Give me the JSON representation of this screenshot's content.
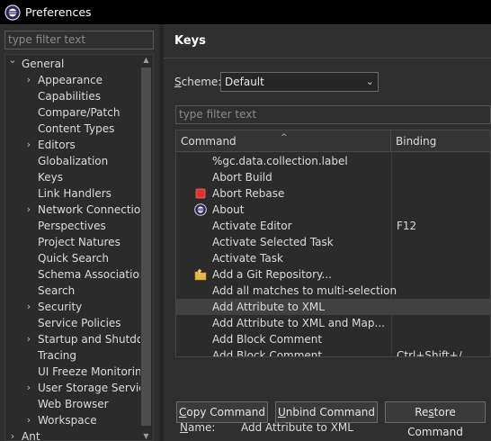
{
  "window": {
    "title": "Preferences"
  },
  "left": {
    "filter_placeholder": "type filter text",
    "tree": [
      {
        "label": "General",
        "expanded": true,
        "level": 0
      },
      {
        "label": "Appearance",
        "expandable": true,
        "level": 1
      },
      {
        "label": "Capabilities",
        "level": 1
      },
      {
        "label": "Compare/Patch",
        "level": 1
      },
      {
        "label": "Content Types",
        "level": 1
      },
      {
        "label": "Editors",
        "expandable": true,
        "level": 1
      },
      {
        "label": "Globalization",
        "level": 1
      },
      {
        "label": "Keys",
        "level": 1
      },
      {
        "label": "Link Handlers",
        "level": 1
      },
      {
        "label": "Network Connections",
        "expandable": true,
        "level": 1
      },
      {
        "label": "Perspectives",
        "level": 1
      },
      {
        "label": "Project Natures",
        "level": 1
      },
      {
        "label": "Quick Search",
        "level": 1
      },
      {
        "label": "Schema Associations",
        "level": 1
      },
      {
        "label": "Search",
        "level": 1
      },
      {
        "label": "Security",
        "expandable": true,
        "level": 1
      },
      {
        "label": "Service Policies",
        "level": 1
      },
      {
        "label": "Startup and Shutdown",
        "expandable": true,
        "level": 1
      },
      {
        "label": "Tracing",
        "level": 1
      },
      {
        "label": "UI Freeze Monitoring",
        "level": 1
      },
      {
        "label": "User Storage Service",
        "expandable": true,
        "level": 1
      },
      {
        "label": "Web Browser",
        "level": 1
      },
      {
        "label": "Workspace",
        "expandable": true,
        "level": 1
      },
      {
        "label": "Ant",
        "expandable": true,
        "level": 0
      }
    ]
  },
  "right": {
    "title": "Keys",
    "scheme": {
      "label_prefix": "S",
      "label_rest": "cheme:",
      "value": "Default"
    },
    "filter_placeholder": "type filter text",
    "columns": {
      "command": "Command",
      "binding": "Binding"
    },
    "rows": [
      {
        "command": "%gc.data.collection.label",
        "binding": "",
        "icon": ""
      },
      {
        "command": "Abort Build",
        "binding": "",
        "icon": ""
      },
      {
        "command": "Abort Rebase",
        "binding": "",
        "icon": "stop-icon"
      },
      {
        "command": "About",
        "binding": "",
        "icon": "eclipse-icon"
      },
      {
        "command": "Activate Editor",
        "binding": "F12",
        "icon": ""
      },
      {
        "command": "Activate Selected Task",
        "binding": "",
        "icon": ""
      },
      {
        "command": "Activate Task",
        "binding": "",
        "icon": ""
      },
      {
        "command": "Add a Git Repository...",
        "binding": "",
        "icon": "git-repo-icon"
      },
      {
        "command": "Add all matches to multi-selection",
        "binding": "",
        "icon": ""
      },
      {
        "command": "Add Attribute to XML",
        "binding": "",
        "icon": "",
        "selected": true
      },
      {
        "command": "Add Attribute to XML and Map...",
        "binding": "",
        "icon": ""
      },
      {
        "command": "Add Block Comment",
        "binding": "",
        "icon": ""
      },
      {
        "command": "Add Block Comment",
        "binding": "Ctrl+Shift+/",
        "icon": ""
      }
    ],
    "buttons": {
      "copy": {
        "mn": "C",
        "rest": "opy Command"
      },
      "unbind": {
        "mn": "U",
        "rest": "nbind Command"
      },
      "restore": {
        "pre": "Re",
        "mn": "s",
        "rest": "tore Command"
      }
    },
    "name": {
      "label_prefix": "N",
      "label_rest": "ame:",
      "value": "Add Attribute to XML"
    }
  },
  "colors": {
    "background": "#2f2f2f",
    "titlebar": "#000000",
    "selection": "#414141"
  }
}
